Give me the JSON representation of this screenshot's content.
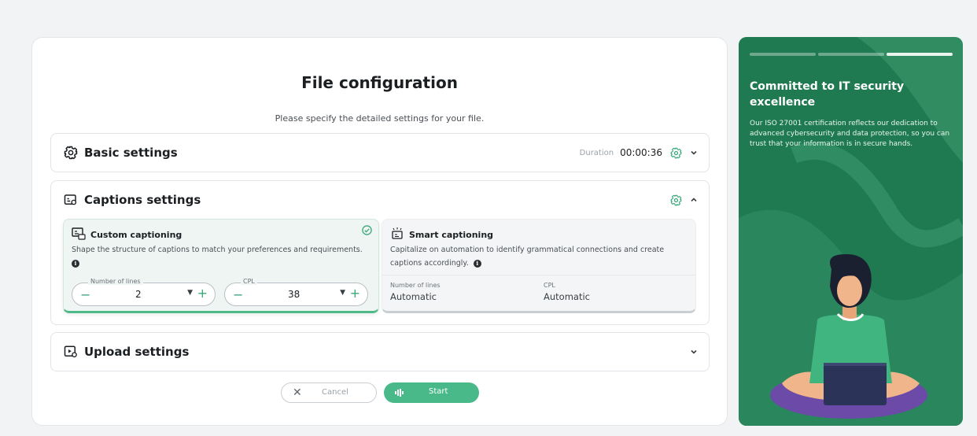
{
  "page": {
    "title": "File configuration",
    "subtitle": "Please specify the detailed settings for your file."
  },
  "basic": {
    "title": "Basic settings",
    "duration_label": "Duration",
    "duration_value": "00:00:36"
  },
  "captions": {
    "title": "Captions settings",
    "custom": {
      "title": "Custom captioning",
      "description": "Shape the structure of captions to match your preferences and requirements.",
      "selected": true,
      "lines_label": "Number of lines",
      "lines_value": "2",
      "cpl_label": "CPL",
      "cpl_value": "38"
    },
    "smart": {
      "title": "Smart captioning",
      "description": "Capitalize on automation to identify grammatical connections and create captions accordingly.",
      "lines_label": "Number of lines",
      "lines_value": "Automatic",
      "cpl_label": "CPL",
      "cpl_value": "Automatic"
    }
  },
  "upload": {
    "title": "Upload settings"
  },
  "buttons": {
    "cancel": "Cancel",
    "start": "Start"
  },
  "side": {
    "title": "Committed to IT security excellence",
    "text": "Our ISO 27001 certification reflects our dedication to advanced cybersecurity and data protection, so you can trust that your information is in secure hands.",
    "slides_total": 3,
    "slide_active": 3
  },
  "colors": {
    "accent": "#49b98a",
    "side_bg": "#1f7a51"
  },
  "icons": {
    "basic": "gear-icon",
    "captions": "captions-settings-icon",
    "upload": "upload-video-icon",
    "custom": "custom-caption-icon",
    "smart": "smart-caption-icon"
  }
}
